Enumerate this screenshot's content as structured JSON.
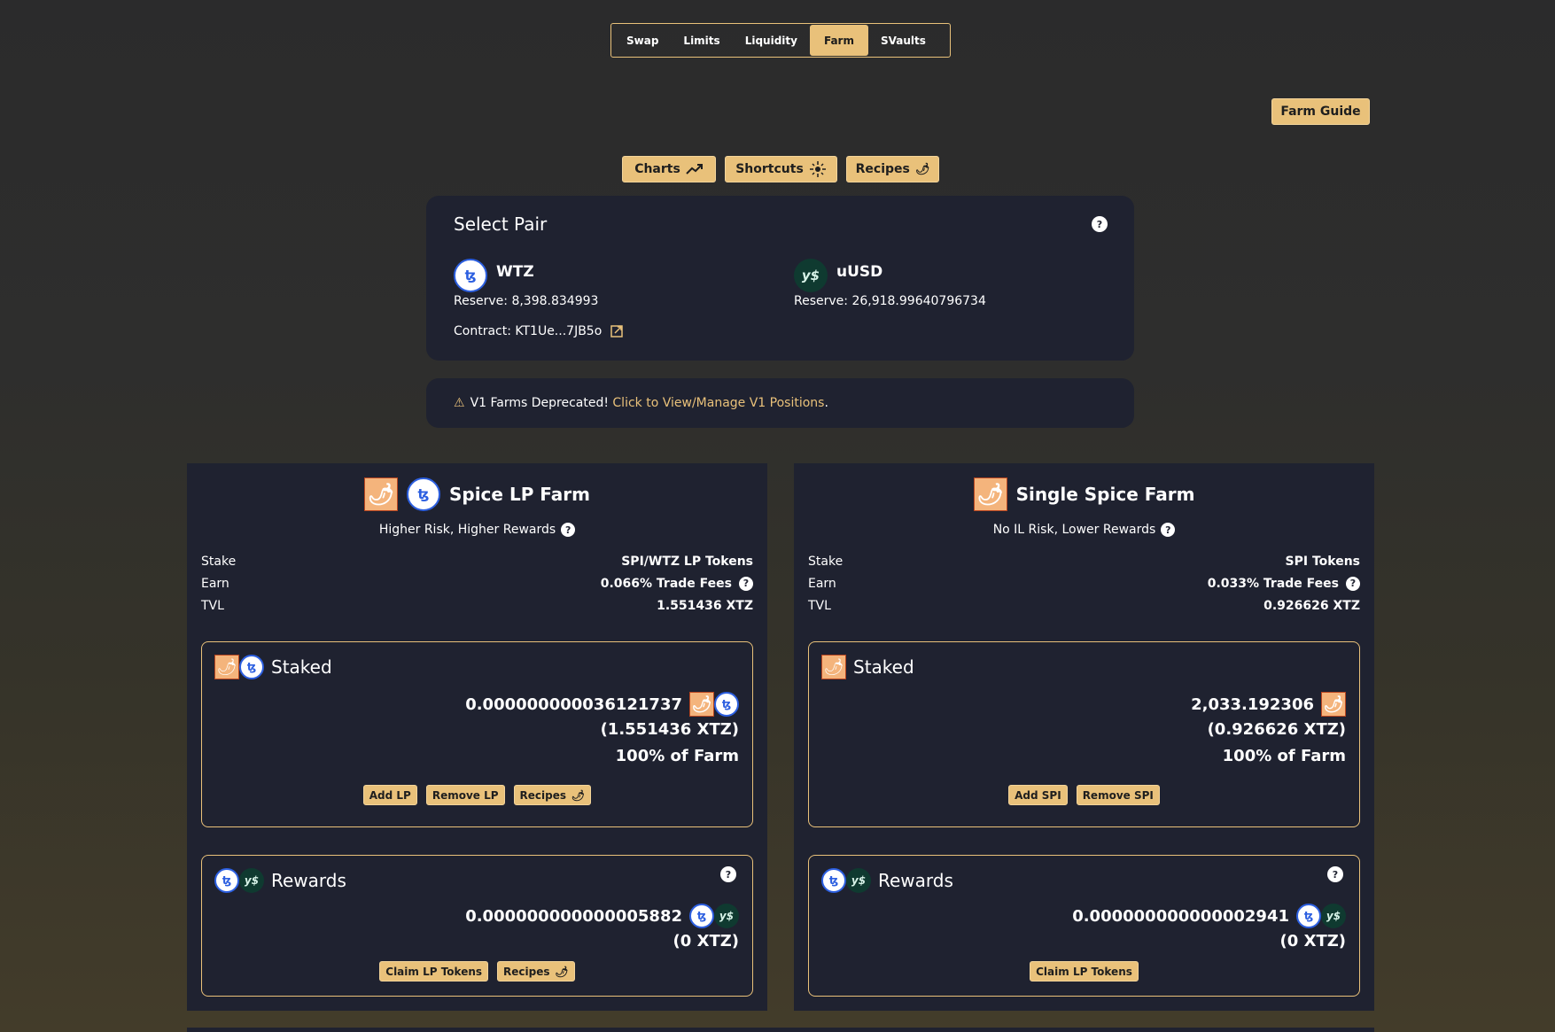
{
  "nav": {
    "tabs": [
      {
        "label": "Swap"
      },
      {
        "label": "Limits"
      },
      {
        "label": "Liquidity"
      },
      {
        "label": "Farm",
        "active": true
      },
      {
        "label": "SVaults"
      }
    ]
  },
  "farm_guide": "Farm Guide",
  "tools": {
    "charts": "Charts",
    "shortcuts": "Shortcuts",
    "recipes": "Recipes"
  },
  "select_pair": {
    "title": "Select Pair",
    "token_a": {
      "symbol": "WTZ",
      "reserve": "Reserve: 8,398.834993"
    },
    "token_b": {
      "symbol": "uUSD",
      "reserve": "Reserve: 26,918.99640796734"
    },
    "contract": "Contract: KT1Ue...7JB5o"
  },
  "warning": {
    "text": "V1 Farms Deprecated! ",
    "link": "Click to View/Manage V1 Positions",
    "end": "."
  },
  "farms": [
    {
      "title": "Spice LP Farm",
      "subtitle": "Higher Risk, Higher Rewards",
      "stake_label": "Stake",
      "stake": "SPI/WTZ LP Tokens",
      "earn_label": "Earn",
      "earn": "0.066% Trade Fees",
      "tvl_label": "TVL",
      "tvl": "1.551436 XTZ",
      "staked": {
        "title": "Staked",
        "amount": "0.000000000036121737",
        "xtz": "(1.551436 XTZ)",
        "share": "100% of Farm",
        "buttons": [
          "Add LP",
          "Remove LP",
          "Recipes"
        ]
      },
      "rewards": {
        "title": "Rewards",
        "amount": "0.000000000000005882",
        "xtz": "(0 XTZ)",
        "buttons": [
          "Claim LP Tokens",
          "Recipes"
        ]
      }
    },
    {
      "title": "Single Spice Farm",
      "subtitle": "No IL Risk, Lower Rewards",
      "stake_label": "Stake",
      "stake": "SPI Tokens",
      "earn_label": "Earn",
      "earn": "0.033% Trade Fees",
      "tvl_label": "TVL",
      "tvl": "0.926626 XTZ",
      "staked": {
        "title": "Staked",
        "amount": "2,033.192306",
        "xtz": "(0.926626 XTZ)",
        "share": "100% of Farm",
        "buttons": [
          "Add SPI",
          "Remove SPI"
        ]
      },
      "rewards": {
        "title": "Rewards",
        "amount": "0.000000000000002941",
        "xtz": "(0 XTZ)",
        "buttons": [
          "Claim LP Tokens"
        ]
      }
    }
  ],
  "colors": {
    "accent": "#e9c17a",
    "card": "#1f2230",
    "background": "#2c2c2c"
  }
}
